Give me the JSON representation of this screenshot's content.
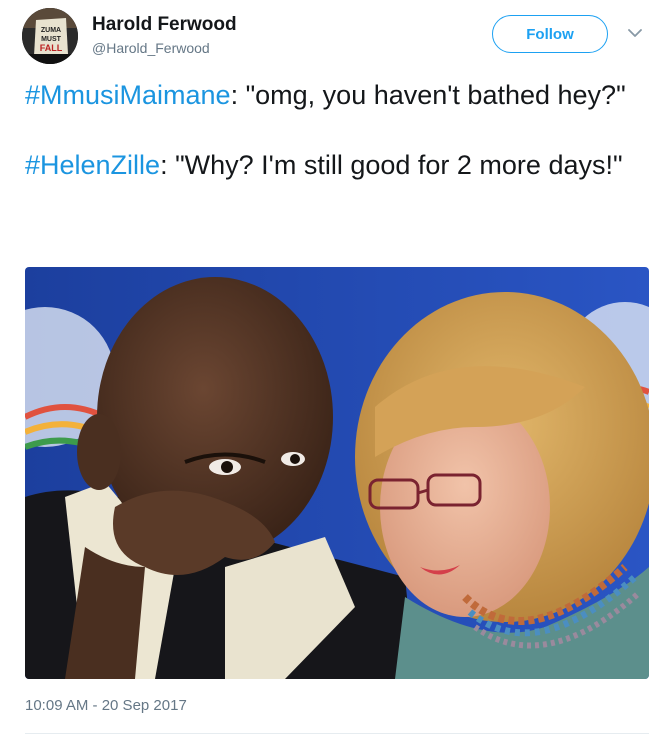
{
  "author": {
    "name": "Harold Ferwood",
    "handle": "@Harold_Ferwood",
    "avatar_icon": "avatar-protest-sign-icon",
    "avatar_sign_text": "ZUMA MUST FALL"
  },
  "actions": {
    "follow_label": "Follow",
    "menu_icon": "chevron-down-icon"
  },
  "tweet": {
    "lines": [
      {
        "hashtag": "#MmusiMaimane",
        "text": ": \"omg, you haven't bathed hey?\""
      },
      {
        "hashtag": "#HelenZille",
        "text": ": \"Why? I'm still good for 2 more days!\""
      }
    ],
    "photo_description_icon": "tweet-photo-icon"
  },
  "meta": {
    "timestamp": "10:09 AM - 20 Sep 2017"
  },
  "colors": {
    "accent": "#1da1f2",
    "hashtag": "#1b95e0",
    "muted": "#657786",
    "text": "#14171a"
  }
}
